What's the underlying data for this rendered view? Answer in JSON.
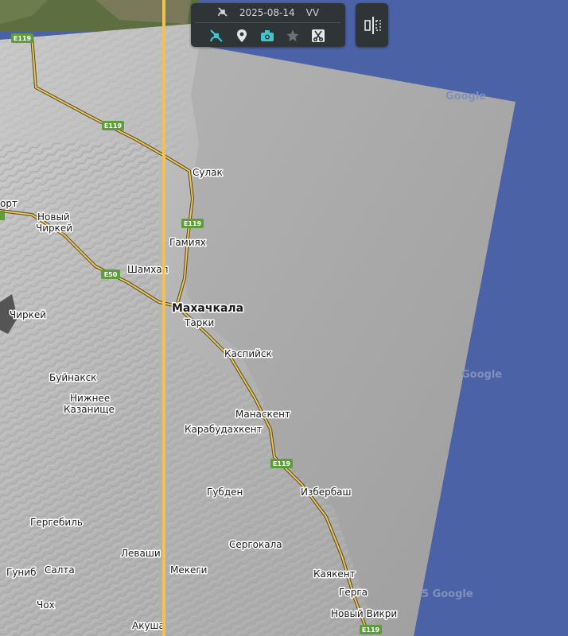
{
  "toolbar": {
    "date": "2025-08-14",
    "polarization": "VV",
    "icons": [
      "satellite-icon",
      "location-pin-icon",
      "camera-icon",
      "star-icon",
      "scissors-icon"
    ]
  },
  "map": {
    "places": [
      {
        "name": "Сулак",
        "kind": "town"
      },
      {
        "name": "Новый",
        "kind": "town"
      },
      {
        "name": "Чиркей",
        "kind": "town"
      },
      {
        "name": "Гамиях",
        "kind": "town"
      },
      {
        "name": "Шамхал",
        "kind": "town"
      },
      {
        "name": "Махачкала",
        "kind": "city"
      },
      {
        "name": "Тарки",
        "kind": "town"
      },
      {
        "name": "Чиркей",
        "kind": "town"
      },
      {
        "name": "Каспийск",
        "kind": "town"
      },
      {
        "name": "Буйнакск",
        "kind": "town"
      },
      {
        "name": "Нижнее",
        "kind": "town"
      },
      {
        "name": "Казанище",
        "kind": "town"
      },
      {
        "name": "Манаскент",
        "kind": "town"
      },
      {
        "name": "Карабудахкент",
        "kind": "town"
      },
      {
        "name": "Губден",
        "kind": "town"
      },
      {
        "name": "Избербаш",
        "kind": "town"
      },
      {
        "name": "Гергебиль",
        "kind": "town"
      },
      {
        "name": "Сергокала",
        "kind": "town"
      },
      {
        "name": "Леваши",
        "kind": "town"
      },
      {
        "name": "Гуниб",
        "kind": "town"
      },
      {
        "name": "Салта",
        "kind": "town"
      },
      {
        "name": "Мекеги",
        "kind": "town"
      },
      {
        "name": "Каякент",
        "kind": "town"
      },
      {
        "name": "Герга",
        "kind": "town"
      },
      {
        "name": "Чох",
        "kind": "town"
      },
      {
        "name": "Акуша",
        "kind": "town"
      },
      {
        "name": "Новый Викри",
        "kind": "town"
      },
      {
        "name": "орт",
        "kind": "town"
      }
    ],
    "road_shields": [
      "E119",
      "E119",
      "E119",
      "E50",
      "E119",
      "E119"
    ],
    "watermarks": [
      "Google",
      "Google",
      "5 Google"
    ],
    "colors": {
      "sea": "#4c62a6",
      "swath": "#a9a9a9",
      "terrain": "#b8b8b8",
      "road": "#d9b75a",
      "shield": "#5e9c3c",
      "split_line": "#f2c14e",
      "accent": "#3ec6d0"
    }
  }
}
